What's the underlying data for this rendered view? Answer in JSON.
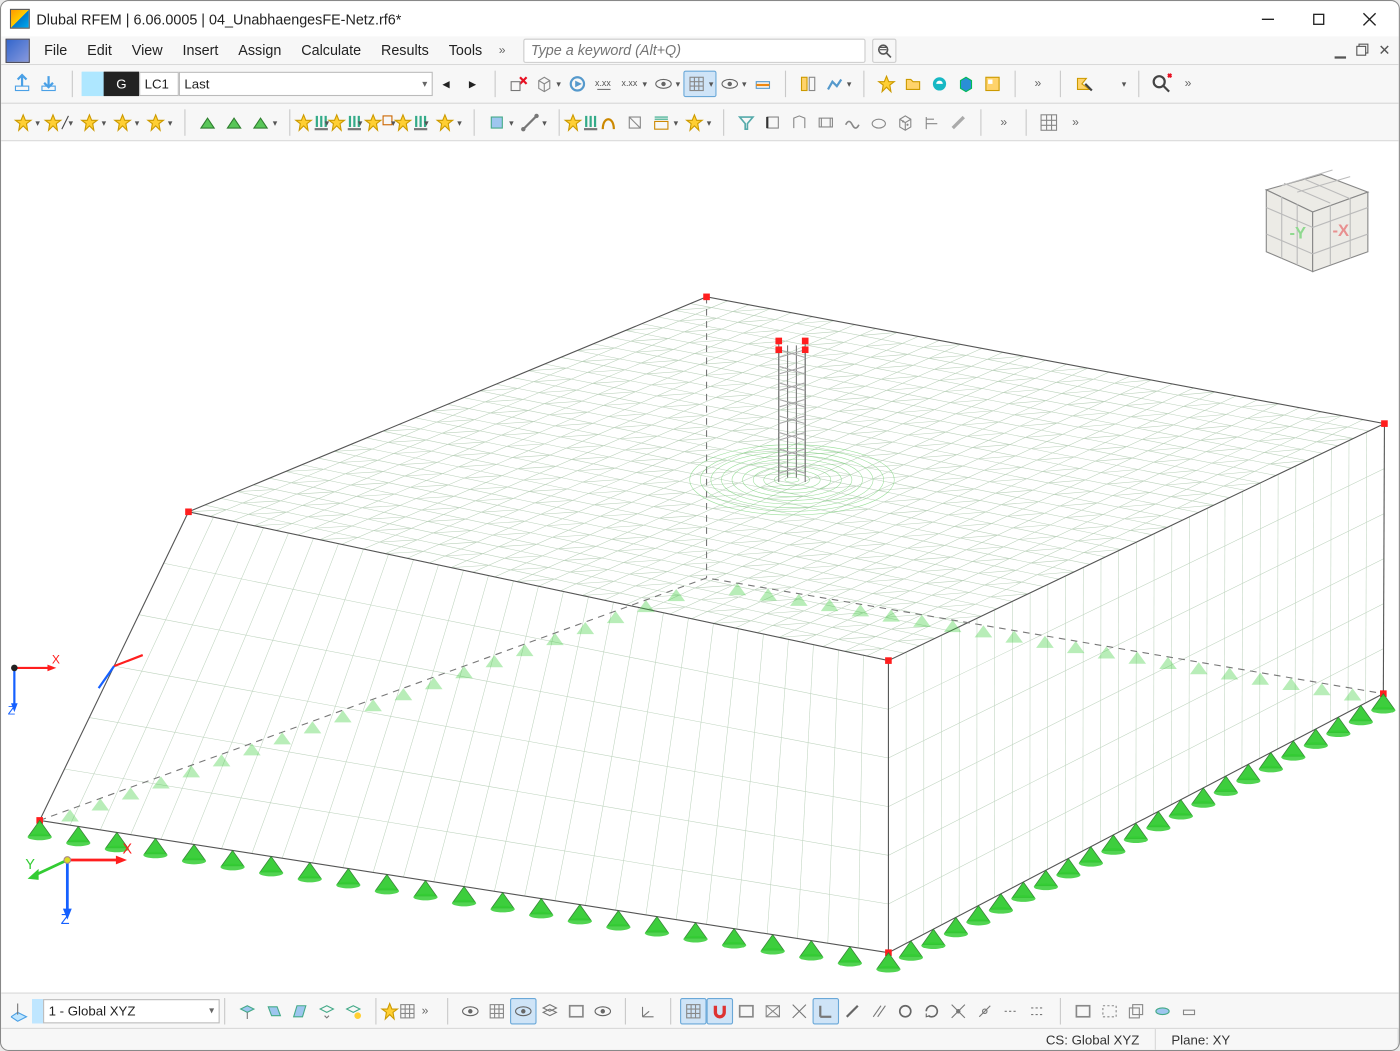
{
  "title": "Dlubal RFEM | 6.06.0005 | 04_UnabhaengesFE-Netz.rf6*",
  "menu": [
    "File",
    "Edit",
    "View",
    "Insert",
    "Assign",
    "Calculate",
    "Results",
    "Tools"
  ],
  "search_placeholder": "Type a keyword (Alt+Q)",
  "lc": {
    "badge": "G",
    "id": "LC1",
    "name": "Last"
  },
  "coord_combo": "1 - Global XYZ",
  "status": {
    "cs": "CS: Global XYZ",
    "plane": "Plane: XY"
  },
  "triad": {
    "x": "X",
    "y": "Y",
    "z": "Z"
  },
  "left_axis": {
    "x": "X",
    "z": "Z"
  },
  "navcube": {
    "y": "-Y",
    "x": "-X"
  },
  "colors": {
    "x_axis": "#ff1e1e",
    "y_axis": "#33cc33",
    "z_axis": "#1560ff",
    "support": "#33cc33",
    "mesh": "#b3ccb3",
    "node": "#ff1e1e"
  }
}
